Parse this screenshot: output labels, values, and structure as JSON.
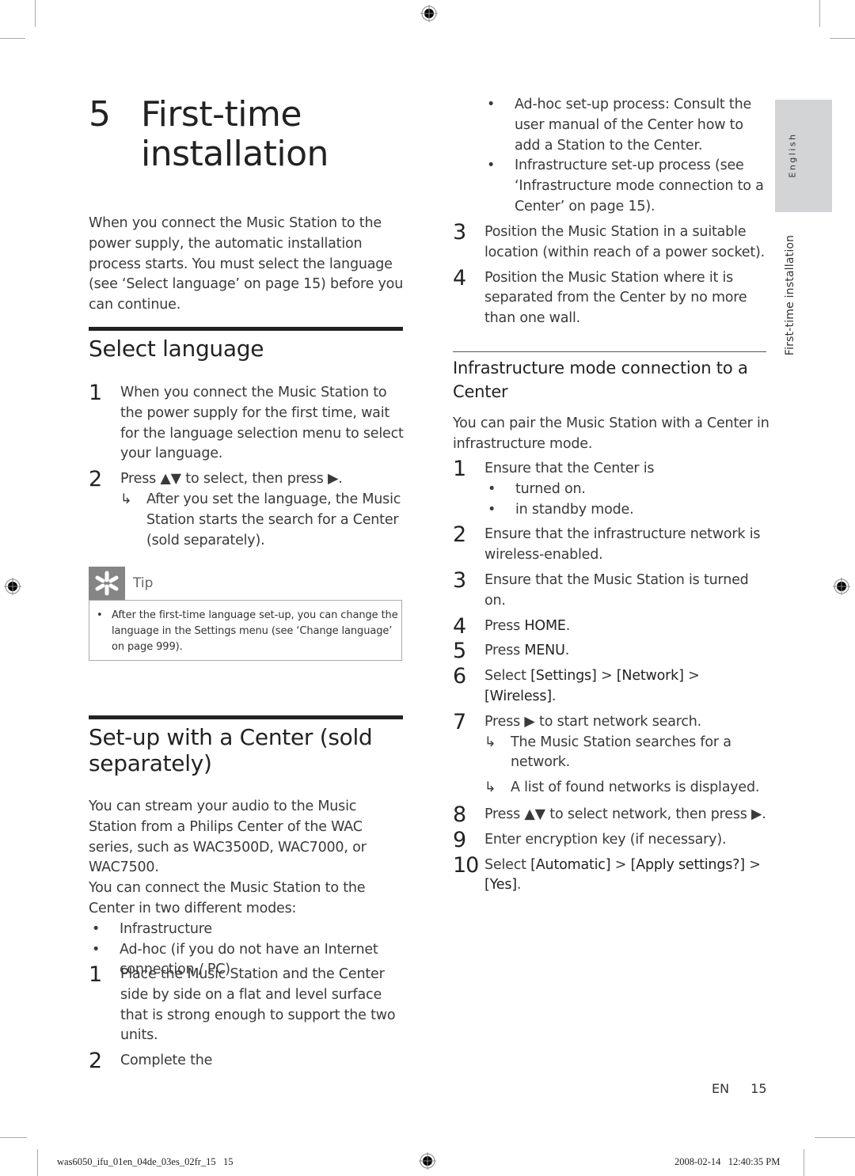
{
  "chapter": {
    "number": "5",
    "title": "First-time installation"
  },
  "intro": "When you connect the Music Station to the power supply, the automatic installation process starts. You must select the language (see ‘Select language’ on page 15) before you can continue.",
  "select_language": {
    "heading": "Select language",
    "steps": [
      {
        "num": "1",
        "text": "When you connect the Music Station to the power supply for the first time, wait for the language selection menu to select your language."
      },
      {
        "num": "2",
        "text": "Press ▲▼ to select, then press ▶.",
        "result": "After you set the language, the Music Station starts the search for a Center (sold separately)."
      }
    ],
    "tip": {
      "label": "Tip",
      "icon": "asterisk-tip-icon",
      "text": "After the first-time language set-up, you can change the language in the Settings menu (see ‘Change language’ on page 999)."
    }
  },
  "setup_center": {
    "heading": "Set-up with a Center (sold separately)",
    "para1": "You can stream your audio to the Music Station from a Philips Center of the WAC series, such as WAC3500D, WAC7000, or WAC7500.",
    "para2": "You can connect the Music Station to the Center in two different modes:",
    "modes": [
      "Infrastructure",
      "Ad-hoc (if you do not have an Internet connection / PC)"
    ],
    "steps": [
      {
        "num": "1",
        "text": "Place the Music Station and the Center side by side on a flat and level surface that is strong enough to support the two units."
      },
      {
        "num": "2",
        "text": "Complete the"
      }
    ],
    "continued_bullets": [
      "Ad-hoc set-up process: Consult the user manual of the Center how to add a Station to the Center.",
      "Infrastructure set-up process (see ‘Infrastructure mode connection to a Center’ on page 15)."
    ],
    "steps_cont": [
      {
        "num": "3",
        "text": "Position the Music Station in a suitable location (within reach of a power socket)."
      },
      {
        "num": "4",
        "text": "Position the Music Station where it is separated from the Center by no more than one wall."
      }
    ]
  },
  "infrastructure": {
    "heading": "Infrastructure mode connection to a Center",
    "intro": "You can pair the Music Station with a Center in infrastructure mode.",
    "step1": {
      "num": "1",
      "text": "Ensure that the Center is",
      "bullets": [
        "turned on.",
        "in standby mode."
      ]
    },
    "step2": {
      "num": "2",
      "text": "Ensure that the infrastructure network is wireless-enabled."
    },
    "step3": {
      "num": "3",
      "text": "Ensure that the Music Station is turned on."
    },
    "step4": {
      "num": "4",
      "pre": "Press ",
      "key": "HOME",
      "post": "."
    },
    "step5": {
      "num": "5",
      "pre": "Press ",
      "key": "MENU",
      "post": "."
    },
    "step6": {
      "num": "6",
      "pre": "Select ",
      "path1": "[Settings]",
      "sep": " > ",
      "path2": "[Network]",
      "path3": "[Wireless]",
      "post": "."
    },
    "step7": {
      "num": "7",
      "text": "Press ▶ to start network search.",
      "results": [
        "The Music Station searches for a network.",
        "A list of found networks is displayed."
      ]
    },
    "step8": {
      "num": "8",
      "text": "Press ▲▼ to select network, then press ▶."
    },
    "step9": {
      "num": "9",
      "text": "Enter encryption key (if necessary)."
    },
    "step10": {
      "num": "10",
      "pre": "Select ",
      "path1": "[Automatic]",
      "sep": " > ",
      "path2": "[Apply settings?]",
      "path3": "[Yes]",
      "post": "."
    }
  },
  "side_tab": {
    "language": "English",
    "section": "First-time installation"
  },
  "footer": {
    "lang": "EN",
    "page": "15"
  },
  "slug": {
    "file": "was6050_ifu_01en_04de_03es_02fr_15   15",
    "date": "2008-02-14   12:40:35 PM"
  },
  "symbols": {
    "bullet": "•",
    "result_arrow": "↳"
  }
}
